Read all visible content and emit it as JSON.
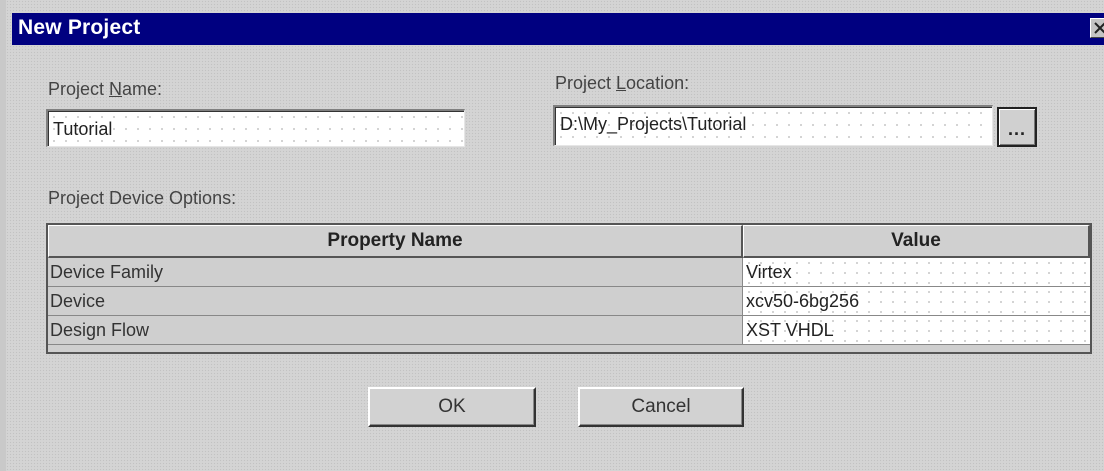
{
  "window": {
    "title": "New Project",
    "close_glyph": "✕"
  },
  "project_name": {
    "label_pre": "Project ",
    "label_accel": "N",
    "label_post": "ame:",
    "value": "Tutorial"
  },
  "project_location": {
    "label_pre": "Project ",
    "label_accel": "L",
    "label_post": "ocation:",
    "value": "D:\\My_Projects\\Tutorial",
    "browse_label": "..."
  },
  "device_options": {
    "label": "Project Device Options:",
    "columns": [
      "Property Name",
      "Value"
    ],
    "rows": [
      {
        "name": "Device Family",
        "value": "Virtex"
      },
      {
        "name": "Device",
        "value": "xcv50-6bg256"
      },
      {
        "name": "Design Flow",
        "value": "XST VHDL"
      }
    ]
  },
  "buttons": {
    "ok": "OK",
    "cancel": "Cancel"
  },
  "colors": {
    "titlebar": "#000080",
    "dialog_bg": "#d4d4d4"
  }
}
